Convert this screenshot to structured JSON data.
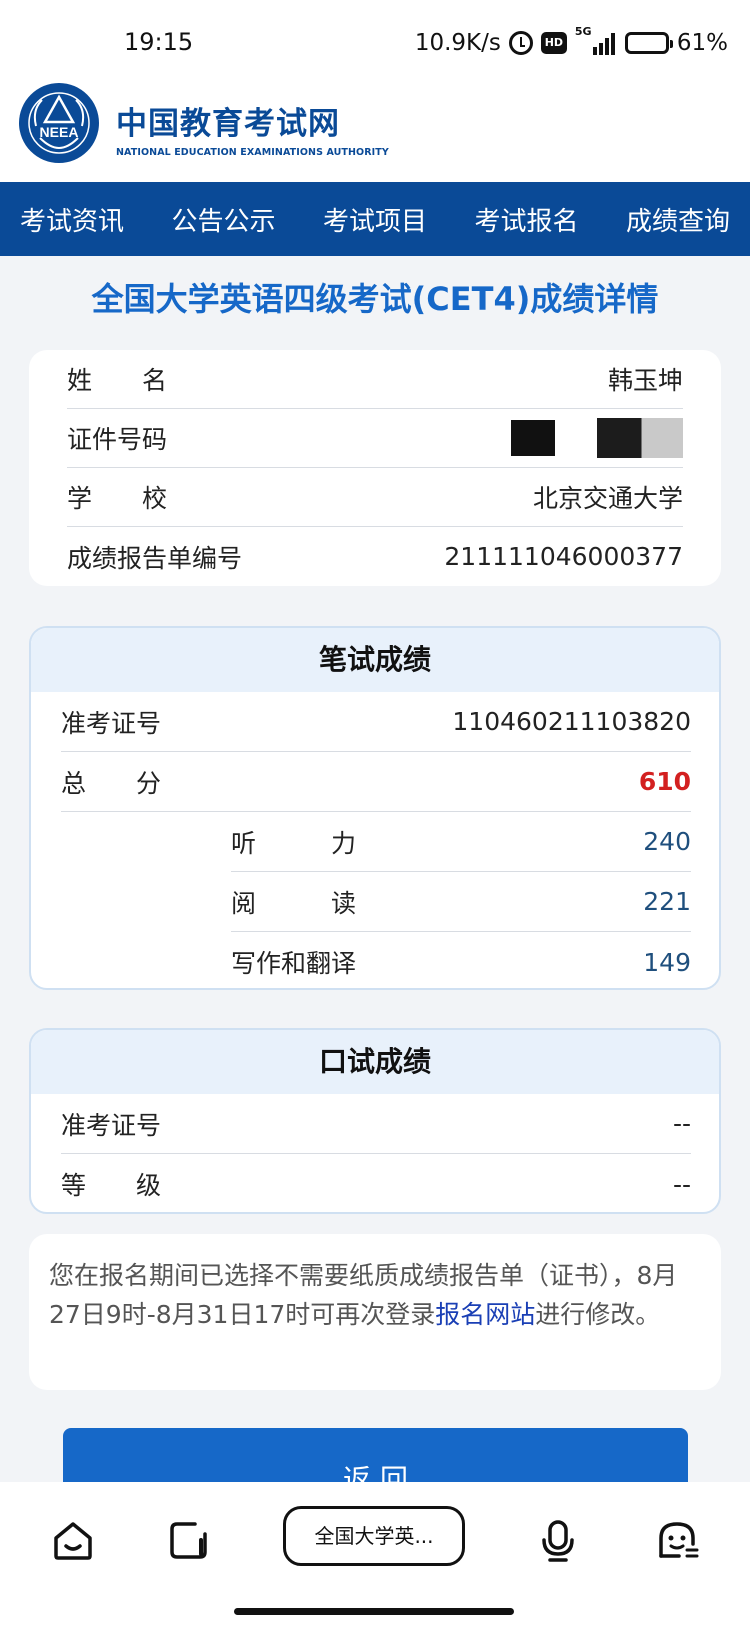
{
  "status_bar": {
    "time": "19:15",
    "net_speed": "10.9K/s",
    "network": "5G",
    "battery": "61%",
    "battery_level": 0.61,
    "icons": [
      "alarm-icon",
      "hd-icon",
      "signal-icon",
      "battery-icon"
    ]
  },
  "header": {
    "logo_badge_text": "NEEA",
    "site_name_cn": "中国教育考试网",
    "site_name_en": "NATIONAL EDUCATION EXAMINATIONS AUTHORITY"
  },
  "nav": {
    "items": [
      "考试资讯",
      "公告公示",
      "考试项目",
      "考试报名",
      "成绩查询"
    ]
  },
  "page_title": "全国大学英语四级考试(CET4)成绩详情",
  "candidate": {
    "name_label": "姓　　名",
    "name": "韩玉坤",
    "id_label": "证件号码",
    "school_label": "学　　校",
    "school": "北京交通大学",
    "report_no_label": "成绩报告单编号",
    "report_no": "211111046000377"
  },
  "written": {
    "title": "笔试成绩",
    "ticket_label": "准考证号",
    "ticket_no": "110460211103820",
    "total_label": "总　　分",
    "total": "610",
    "listening_label": "听　　　力",
    "listening": "240",
    "reading_label": "阅　　　读",
    "reading": "221",
    "writing_label": "写作和翻译",
    "writing": "149"
  },
  "oral": {
    "title": "口试成绩",
    "ticket_label": "准考证号",
    "ticket_no": "--",
    "grade_label": "等　　级",
    "grade": "--"
  },
  "notice": {
    "text_before": "您在报名期间已选择不需要纸质成绩报告单（证书），8月27日9时-8月31日17时可再次登录",
    "link": "报名网站",
    "text_after": "进行修改。"
  },
  "return_button": "返 回",
  "browser_bar": {
    "tab_title": "全国大学英...",
    "icons": [
      "home-icon",
      "tabs-icon",
      "microphone-icon",
      "assistant-icon"
    ]
  },
  "colors": {
    "brand_blue": "#0a4a97",
    "title_blue": "#1668c8",
    "total_red": "#d32020",
    "score_blue": "#1f4f7d",
    "link_blue": "#1a3fb5"
  }
}
